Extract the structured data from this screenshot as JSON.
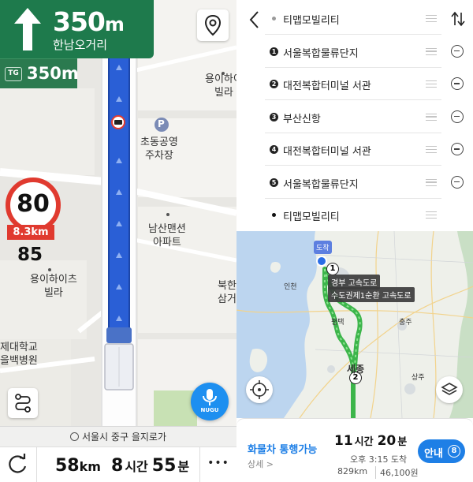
{
  "navigation": {
    "turn": {
      "distance": "350",
      "distance_unit": "m",
      "name": "한남오거리"
    },
    "secondary": {
      "tag": "TG",
      "distance": "350m"
    },
    "speed_limit": "80",
    "camera_distance": "8.3km",
    "current_speed": "85",
    "map_labels": {
      "building_1": "용이하이\n빌라",
      "parking": "초동공영\n주차장",
      "parking_symbol": "P",
      "apartment": "남산맨션\n아파트",
      "building_2": "용이하이츠\n빌라",
      "hospital": "제대학교\n을백병원",
      "north": "북한\n삼거"
    },
    "nugu_label": "NUGU",
    "address": "서울시 중구 을지로가",
    "bottom": {
      "distance": "58",
      "distance_unit": "km",
      "hours": "8",
      "hours_unit": "시간",
      "minutes": "55",
      "minutes_unit": "분",
      "more": "•••"
    }
  },
  "route": {
    "waypoints": [
      {
        "name": "티맵모빌리티",
        "badge": "",
        "type": "start"
      },
      {
        "name": "서울복합물류단지",
        "badge": "1",
        "type": "via"
      },
      {
        "name": "대전복합터미널 서관",
        "badge": "2",
        "type": "via"
      },
      {
        "name": "부산신항",
        "badge": "3",
        "type": "via"
      },
      {
        "name": "대전복합터미널 서관",
        "badge": "4",
        "type": "via"
      },
      {
        "name": "서울복합물류단지",
        "badge": "5",
        "type": "via"
      },
      {
        "name": "티맵모빌리티",
        "badge": "",
        "type": "end"
      }
    ],
    "map": {
      "arrival_tag": "도착",
      "highway_1": "경부 고속도로",
      "highway_2": "수도권제1순환 고속도로",
      "marker_1": "1",
      "marker_2": "2",
      "cities": [
        "인천",
        "평택",
        "충주",
        "세종",
        "상주"
      ]
    },
    "summary": {
      "truck_ok": "화물차 통행가능",
      "detail": "상세 >",
      "duration_hours": "11",
      "duration_hours_unit": "시간",
      "duration_minutes": "20",
      "duration_minutes_unit": "분",
      "arrival": "오후 3:15 도착",
      "distance": "829km",
      "toll": "46,100원",
      "guide_label": "안내",
      "guide_count": "8"
    }
  },
  "colors": {
    "nav_green": "#1e7a4c",
    "route_blue": "#2a5fd6",
    "speed_red": "#e03a2f",
    "accent_blue": "#1e7fe6",
    "route_green": "#3cb54a"
  }
}
